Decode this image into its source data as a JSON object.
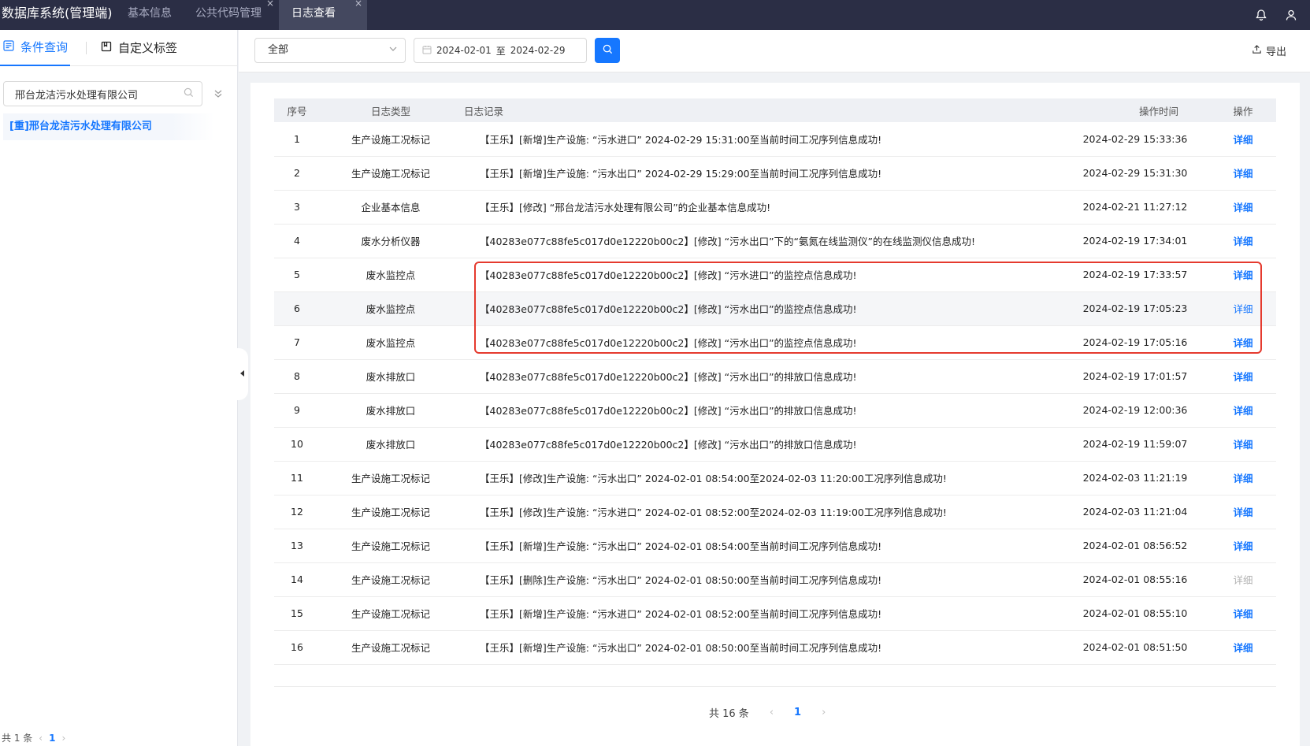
{
  "header": {
    "app_title": "数据库系统(管理端)",
    "tabs": [
      {
        "label": "基本信息"
      },
      {
        "label": "公共代码管理",
        "close": "×"
      },
      {
        "label": "日志查看",
        "close": "×"
      }
    ],
    "icons": [
      "bell-icon",
      "user-icon"
    ]
  },
  "left_panel": {
    "tabs": [
      {
        "label": "条件查询"
      },
      {
        "label": "自定义标签"
      }
    ],
    "search_value": "邢台龙洁污水处理有限公司",
    "tree_item": "[重]邢台龙洁污水处理有限公司",
    "pager": {
      "total": "共 1 条",
      "page": "1",
      "prev": "‹",
      "next": "›"
    }
  },
  "toolbar": {
    "select_value": "全部",
    "date_start": "2024-02-01",
    "date_sep": "至",
    "date_end": "2024-02-29",
    "export_label": "导出"
  },
  "table": {
    "columns": [
      "序号",
      "日志类型",
      "日志记录",
      "操作时间",
      "操作"
    ],
    "rows": [
      {
        "no": "1",
        "type": "生产设施工况标记",
        "record": "【王乐】[新增]生产设施: “污水进口” 2024-02-29 15:31:00至当前时间工况序列信息成功!",
        "time": "2024-02-29 15:33:36",
        "op": "详细"
      },
      {
        "no": "2",
        "type": "生产设施工况标记",
        "record": "【王乐】[新增]生产设施: “污水出口” 2024-02-29 15:29:00至当前时间工况序列信息成功!",
        "time": "2024-02-29 15:31:30",
        "op": "详细"
      },
      {
        "no": "3",
        "type": "企业基本信息",
        "record": "【王乐】[修改] “邢台龙洁污水处理有限公司”的企业基本信息成功!",
        "time": "2024-02-21 11:27:12",
        "op": "详细"
      },
      {
        "no": "4",
        "type": "废水分析仪器",
        "record": "【40283e077c88fe5c017d0e12220b00c2】[修改] “污水出口”下的“氨氮在线监测仪”的在线监测仪信息成功!",
        "time": "2024-02-19 17:34:01",
        "op": "详细"
      },
      {
        "no": "5",
        "type": "废水监控点",
        "record": "【40283e077c88fe5c017d0e12220b00c2】[修改] “污水进口”的监控点信息成功!",
        "time": "2024-02-19 17:33:57",
        "op": "详细"
      },
      {
        "no": "6",
        "type": "废水监控点",
        "record": "【40283e077c88fe5c017d0e12220b00c2】[修改] “污水出口”的监控点信息成功!",
        "time": "2024-02-19 17:05:23",
        "op": "详细"
      },
      {
        "no": "7",
        "type": "废水监控点",
        "record": "【40283e077c88fe5c017d0e12220b00c2】[修改] “污水出口”的监控点信息成功!",
        "time": "2024-02-19 17:05:16",
        "op": "详细"
      },
      {
        "no": "8",
        "type": "废水排放口",
        "record": "【40283e077c88fe5c017d0e12220b00c2】[修改] “污水出口”的排放口信息成功!",
        "time": "2024-02-19 17:01:57",
        "op": "详细"
      },
      {
        "no": "9",
        "type": "废水排放口",
        "record": "【40283e077c88fe5c017d0e12220b00c2】[修改] “污水出口”的排放口信息成功!",
        "time": "2024-02-19 12:00:36",
        "op": "详细"
      },
      {
        "no": "10",
        "type": "废水排放口",
        "record": "【40283e077c88fe5c017d0e12220b00c2】[修改] “污水出口”的排放口信息成功!",
        "time": "2024-02-19 11:59:07",
        "op": "详细"
      },
      {
        "no": "11",
        "type": "生产设施工况标记",
        "record": "【王乐】[修改]生产设施: “污水出口” 2024-02-01 08:54:00至2024-02-03 11:20:00工况序列信息成功!",
        "time": "2024-02-03 11:21:19",
        "op": "详细"
      },
      {
        "no": "12",
        "type": "生产设施工况标记",
        "record": "【王乐】[修改]生产设施: “污水进口” 2024-02-01 08:52:00至2024-02-03 11:19:00工况序列信息成功!",
        "time": "2024-02-03 11:21:04",
        "op": "详细"
      },
      {
        "no": "13",
        "type": "生产设施工况标记",
        "record": "【王乐】[新增]生产设施: “污水出口” 2024-02-01 08:54:00至当前时间工况序列信息成功!",
        "time": "2024-02-01 08:56:52",
        "op": "详细"
      },
      {
        "no": "14",
        "type": "生产设施工况标记",
        "record": "【王乐】[删除]生产设施: “污水出口” 2024-02-01 08:50:00至当前时间工况序列信息成功!",
        "time": "2024-02-01 08:55:16",
        "op": "详细"
      },
      {
        "no": "15",
        "type": "生产设施工况标记",
        "record": "【王乐】[新增]生产设施: “污水进口” 2024-02-01 08:52:00至当前时间工况序列信息成功!",
        "time": "2024-02-01 08:55:10",
        "op": "详细"
      },
      {
        "no": "16",
        "type": "生产设施工况标记",
        "record": "【王乐】[新增]生产设施: “污水出口” 2024-02-01 08:50:00至当前时间工况序列信息成功!",
        "time": "2024-02-01 08:51:50",
        "op": "详细"
      }
    ]
  },
  "pager": {
    "total": "共 16 条",
    "page": "1",
    "prev": "‹",
    "next": "›"
  },
  "colors": {
    "accent": "#1677ff",
    "topbar": "#2b2e45",
    "highlight_box": "#e53a2e"
  }
}
